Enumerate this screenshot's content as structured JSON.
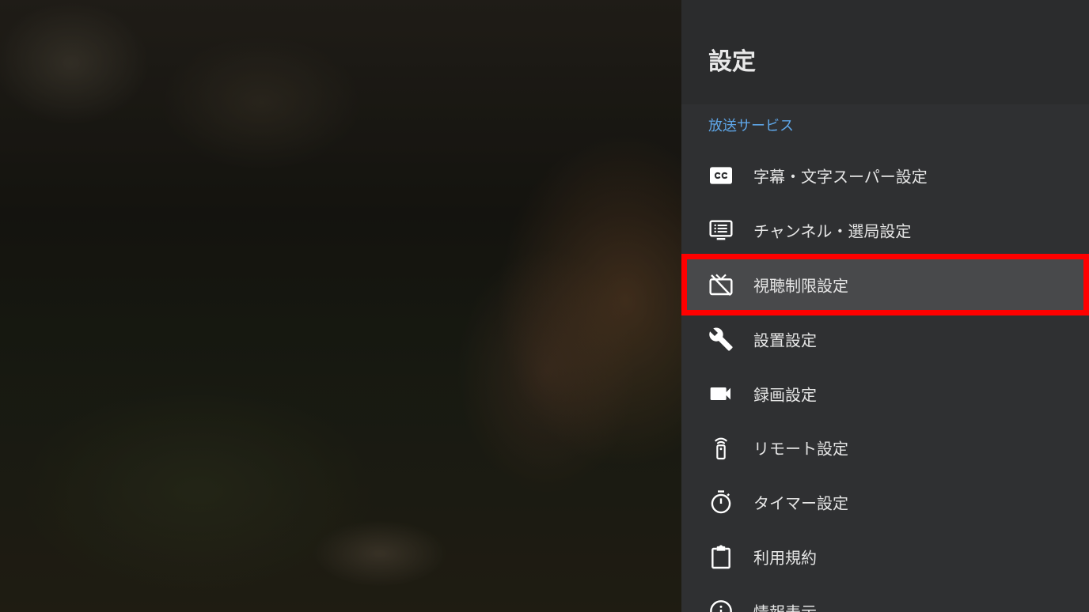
{
  "panel": {
    "title": "設定",
    "section_label": "放送サービス",
    "accent_color": "#5ea6e8",
    "highlight_color": "#ff0000",
    "items": [
      {
        "label": "字幕・文字スーパー設定",
        "icon": "closed-caption-icon"
      },
      {
        "label": "チャンネル・選局設定",
        "icon": "channel-list-icon"
      },
      {
        "label": "視聴制限設定",
        "icon": "tv-off-icon",
        "selected": true
      },
      {
        "label": "設置設定",
        "icon": "wrench-icon"
      },
      {
        "label": "録画設定",
        "icon": "video-camera-icon"
      },
      {
        "label": "リモート設定",
        "icon": "remote-icon"
      },
      {
        "label": "タイマー設定",
        "icon": "timer-icon"
      },
      {
        "label": "利用規約",
        "icon": "clipboard-icon"
      },
      {
        "label": "情報表示",
        "icon": "info-icon"
      }
    ]
  }
}
